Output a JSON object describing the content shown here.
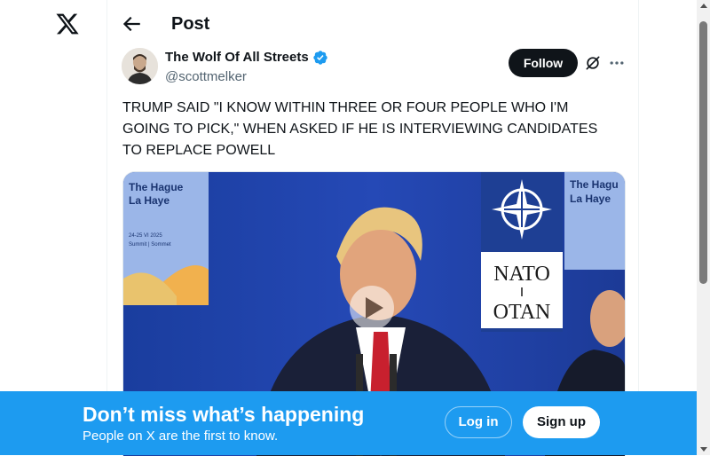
{
  "header": {
    "title": "Post"
  },
  "tweet": {
    "author_name": "The Wolf Of All Streets",
    "author_handle": "@scottmelker",
    "follow_label": "Follow",
    "text": "TRUMP SAID \"I KNOW WITHIN THREE OR FOUR PEOPLE WHO I'M\nGOING TO PICK,\" WHEN ASKED IF HE IS INTERVIEWING CANDIDATES\nTO REPLACE POWELL",
    "media": {
      "left_sign_line1": "The Hague",
      "left_sign_line2": "La Haye",
      "left_sign_line3": "24-25 VI 2025",
      "left_sign_line4": "Summit | Sommet",
      "right_sign_line1": "The Hagu",
      "right_sign_line2": "La Haye",
      "nato_label": "NATO",
      "otan_label": "OTAN"
    }
  },
  "banner": {
    "title": "Don’t miss what’s happening",
    "subtitle": "People on X are the first to know.",
    "login_label": "Log in",
    "signup_label": "Sign up"
  },
  "icons": {
    "logo": "x-logo",
    "back": "arrow-left-icon",
    "verified": "verified-badge-icon",
    "grok": "grok-icon",
    "more": "more-icon",
    "play": "play-icon"
  },
  "colors": {
    "brand_blue": "#1d9bf0",
    "text_primary": "#0f1419",
    "text_secondary": "#536471",
    "verified_blue": "#1d9bf0"
  }
}
